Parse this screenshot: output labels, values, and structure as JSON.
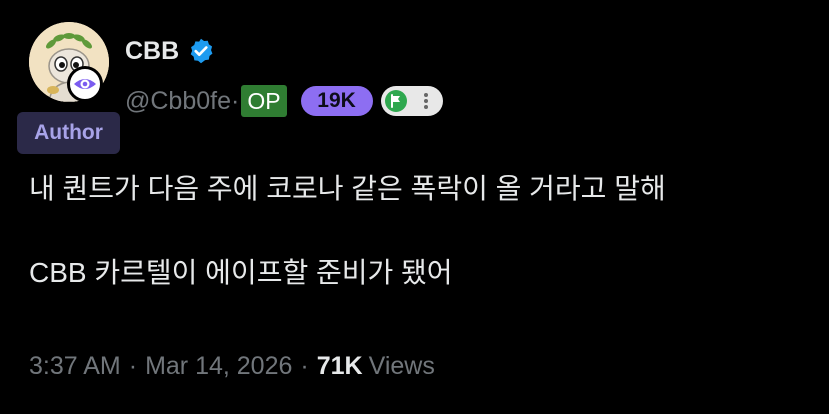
{
  "author": {
    "display_name": "CBB",
    "handle": "@Cbb0fe·",
    "op_label": "OP",
    "followers_badge": "19K",
    "author_tag": "Author",
    "verified": true
  },
  "post": {
    "lines": [
      "내 퀀트가 다음 주에 코로나 같은 폭락이 올 거라고 말해",
      "CBB 카르텔이 에이프할 준비가 됐어"
    ]
  },
  "meta": {
    "time": "3:37 AM",
    "separator": "·",
    "date": "Mar 14, 2026",
    "views_count": "71K",
    "views_label": "Views"
  },
  "icons": {
    "verified": "verified-badge-icon",
    "eye": "eye-icon",
    "flag": "flag-icon",
    "more": "more-vertical-icon"
  },
  "colors": {
    "background": "#000000",
    "verified_blue": "#1d9bf0",
    "op_green": "#2f7d32",
    "followers_purple": "#8d6ef2",
    "author_tag_bg": "#2b2948",
    "author_tag_text": "#a8a3e8"
  }
}
